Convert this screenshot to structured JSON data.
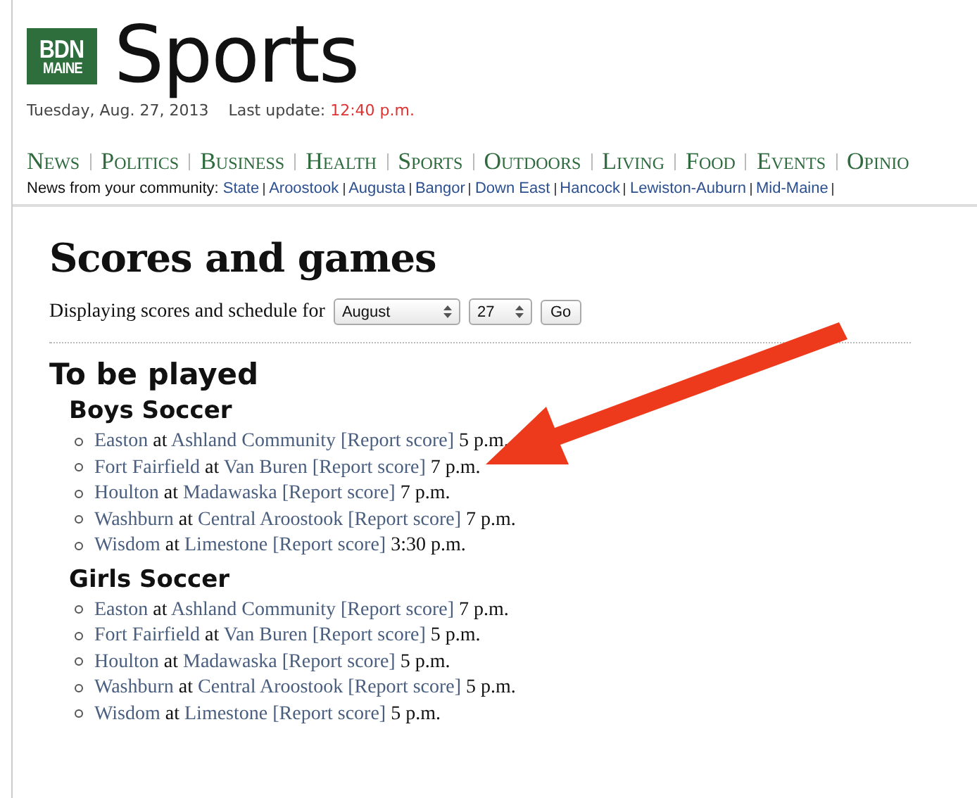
{
  "header": {
    "logo": {
      "line1": "BDN",
      "line2": "MAINE"
    },
    "section_title": "Sports",
    "date": "Tuesday, Aug. 27, 2013",
    "last_update_label": "Last update:",
    "last_update_time": "12:40 p.m."
  },
  "nav": [
    "News",
    "Politics",
    "Business",
    "Health",
    "Sports",
    "Outdoors",
    "Living",
    "Food",
    "Events",
    "Opinio"
  ],
  "community": {
    "label": "News from your community:",
    "links": [
      "State",
      "Aroostook",
      "Augusta",
      "Bangor",
      "Down East",
      "Hancock",
      "Lewiston-Auburn",
      "Mid-Maine"
    ]
  },
  "page": {
    "title": "Scores and games",
    "filter": {
      "label": "Displaying scores and schedule for",
      "month": "August",
      "day": "27",
      "button": "Go"
    },
    "section": "To be played",
    "groups": [
      {
        "title": "Boys Soccer",
        "games": [
          {
            "away": "Easton",
            "connector": "at",
            "home": "Ashland Community",
            "link": "[Report score]",
            "time": "5 p.m."
          },
          {
            "away": "Fort Fairfield",
            "connector": "at",
            "home": "Van Buren",
            "link": "[Report score]",
            "time": "7 p.m."
          },
          {
            "away": "Houlton",
            "connector": "at",
            "home": "Madawaska",
            "link": "[Report score]",
            "time": "7 p.m."
          },
          {
            "away": "Washburn",
            "connector": "at",
            "home": "Central Aroostook",
            "link": "[Report score]",
            "time": "7 p.m."
          },
          {
            "away": "Wisdom",
            "connector": "at",
            "home": "Limestone",
            "link": "[Report score]",
            "time": "3:30 p.m."
          }
        ]
      },
      {
        "title": "Girls Soccer",
        "games": [
          {
            "away": "Easton",
            "connector": "at",
            "home": "Ashland Community",
            "link": "[Report score]",
            "time": "7 p.m."
          },
          {
            "away": "Fort Fairfield",
            "connector": "at",
            "home": "Van Buren",
            "link": "[Report score]",
            "time": "5 p.m."
          },
          {
            "away": "Houlton",
            "connector": "at",
            "home": "Madawaska",
            "link": "[Report score]",
            "time": "5 p.m."
          },
          {
            "away": "Washburn",
            "connector": "at",
            "home": "Central Aroostook",
            "link": "[Report score]",
            "time": "5 p.m."
          },
          {
            "away": "Wisdom",
            "connector": "at",
            "home": "Limestone",
            "link": "[Report score]",
            "time": "5 p.m."
          }
        ]
      }
    ]
  }
}
